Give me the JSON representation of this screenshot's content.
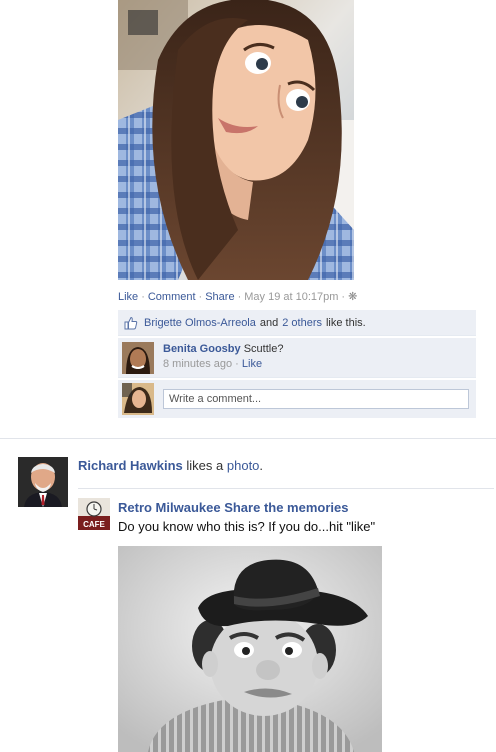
{
  "post1": {
    "actions": {
      "like": "Like",
      "comment": "Comment",
      "share": "Share",
      "timestamp": "May 19 at 10:17pm",
      "privacy_icon": "gear-globe-icon",
      "separator": "·"
    },
    "likes": {
      "icon": "thumbs-up-icon",
      "name": "Brigette Olmos-Arreola",
      "and": "and",
      "others": "2 others",
      "suffix": "like this."
    },
    "comment": {
      "author": "Benita Goosby",
      "text": "Scuttle?",
      "time": "8 minutes ago",
      "like": "Like"
    },
    "write_comment": {
      "placeholder": "Write a comment..."
    }
  },
  "post2": {
    "actor": "Richard Hawkins",
    "verb": "likes a",
    "object": "photo",
    "period": ".",
    "page_name": "Retro Milwaukee Share the memories",
    "page_icon_text": "CAFE",
    "message": "Do you know who this is? If you do...hit \"like\""
  },
  "colors": {
    "link": "#3b5998",
    "ufi_bg": "#eceff5",
    "muted": "#999999"
  }
}
